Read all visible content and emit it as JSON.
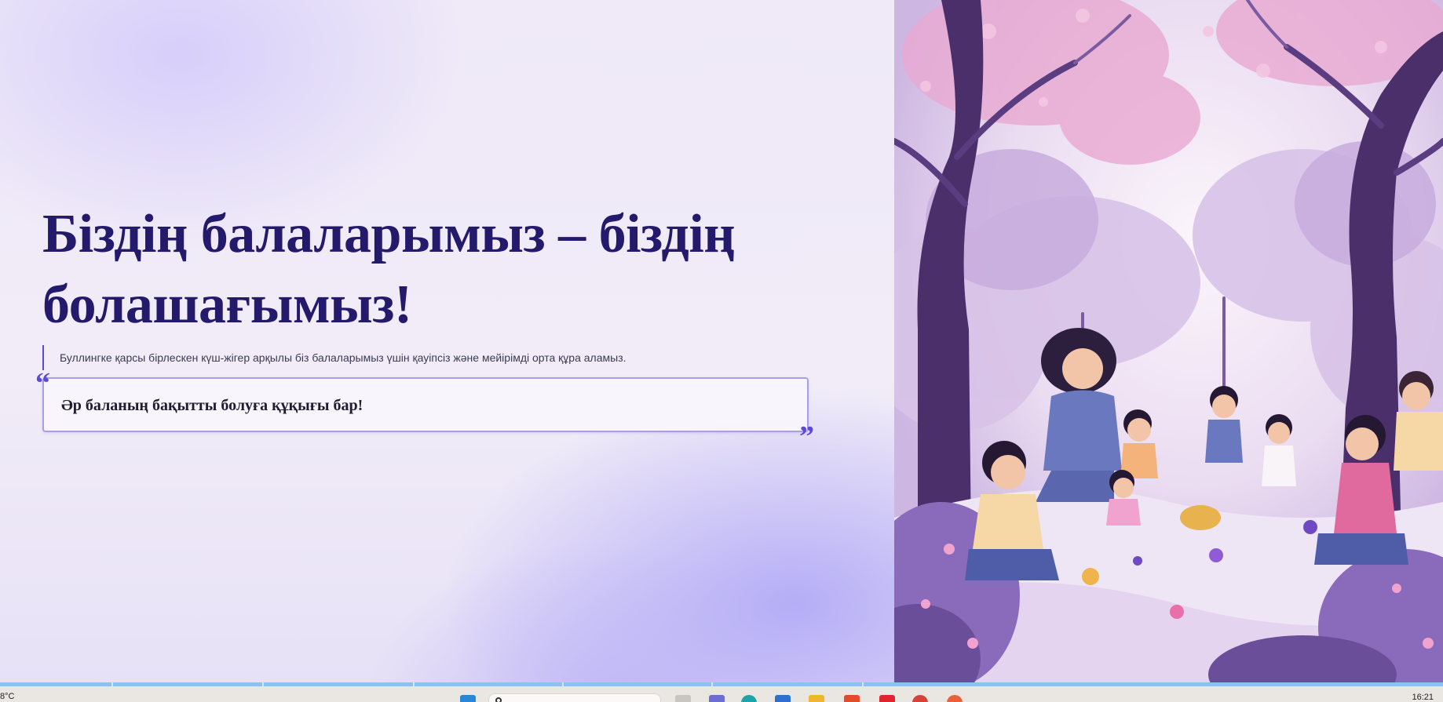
{
  "slide": {
    "headline": "Біздің балаларымыз – біздің болашағымыз!",
    "subtitle": "Буллингке қарсы бірлескен күш-жігер арқылы біз балаларымыз үшін қауіпсіз және мейірімді орта құра аламыз.",
    "quote": "Әр баланың бақытты болуға құқығы бар!",
    "quote_open_mark": "“",
    "quote_close_mark": "”",
    "colors": {
      "headline": "#241a6b",
      "accent": "#5a4ad4",
      "quote_border": "#a99fe6"
    }
  },
  "taskbar": {
    "weather": "8°C",
    "time": "16:21",
    "icons": [
      "windows-start-icon",
      "search-icon",
      "task-view-icon",
      "teams-icon",
      "edge-icon",
      "mail-icon",
      "file-explorer-icon",
      "office-icon",
      "youtube-icon",
      "chrome-icon",
      "browser-icon"
    ]
  }
}
